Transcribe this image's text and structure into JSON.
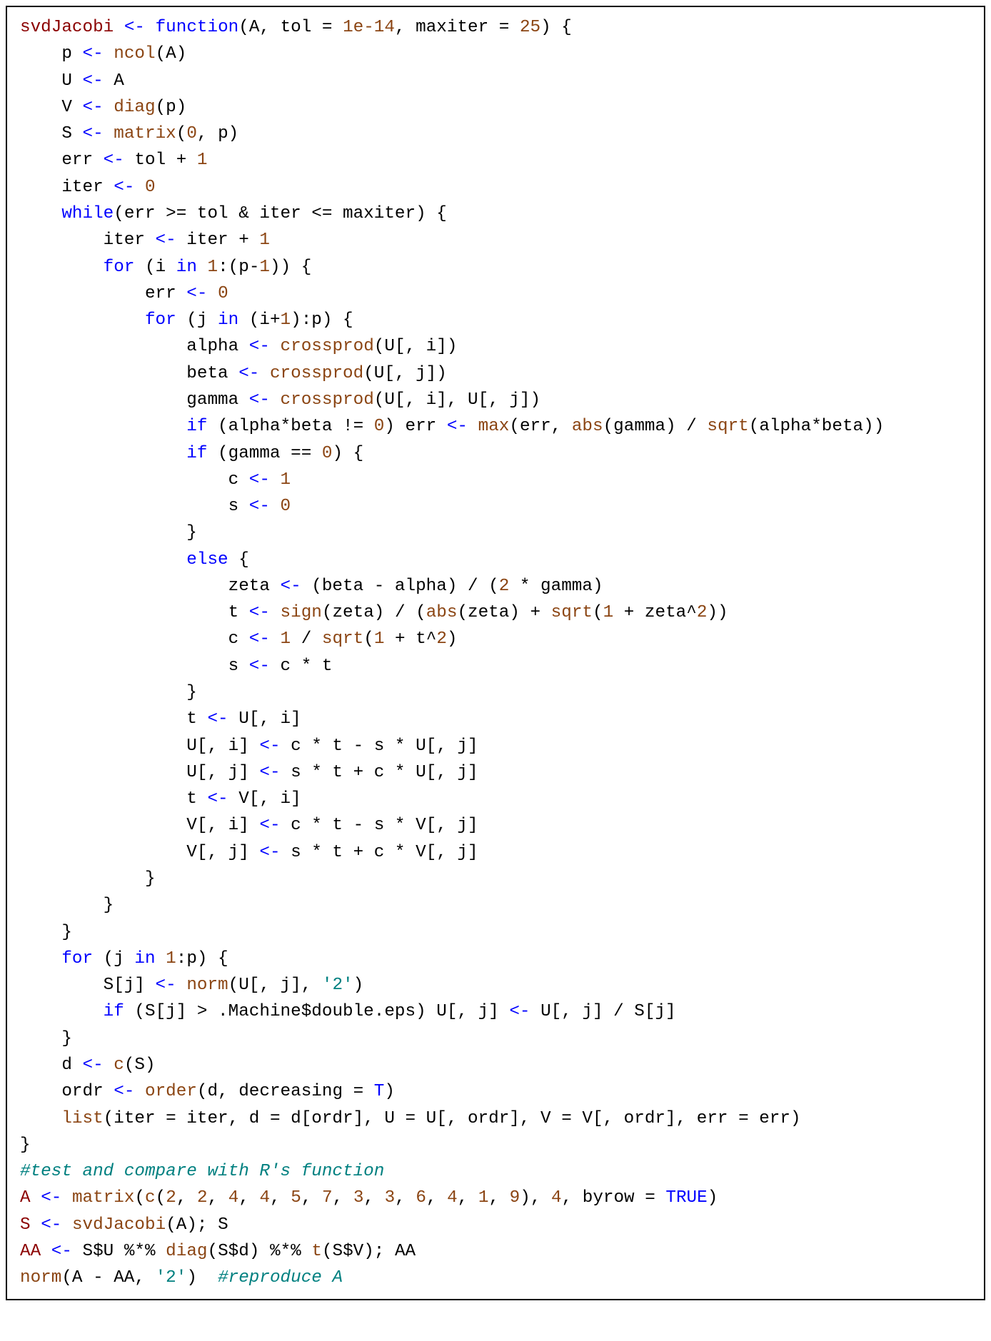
{
  "code_lines": [
    [
      [
        "name",
        "svdJacobi"
      ],
      [
        "op",
        " "
      ],
      [
        "kw",
        "<-"
      ],
      [
        "op",
        " "
      ],
      [
        "kw",
        "function"
      ],
      [
        "op",
        "(A, tol = "
      ],
      [
        "num",
        "1e-14"
      ],
      [
        "op",
        ", maxiter = "
      ],
      [
        "num",
        "25"
      ],
      [
        "op",
        ") {"
      ]
    ],
    [
      [
        "op",
        "    p "
      ],
      [
        "kw",
        "<-"
      ],
      [
        "op",
        " "
      ],
      [
        "fn",
        "ncol"
      ],
      [
        "op",
        "(A)"
      ]
    ],
    [
      [
        "op",
        "    U "
      ],
      [
        "kw",
        "<-"
      ],
      [
        "op",
        " A"
      ]
    ],
    [
      [
        "op",
        "    V "
      ],
      [
        "kw",
        "<-"
      ],
      [
        "op",
        " "
      ],
      [
        "fn",
        "diag"
      ],
      [
        "op",
        "(p)"
      ]
    ],
    [
      [
        "op",
        "    S "
      ],
      [
        "kw",
        "<-"
      ],
      [
        "op",
        " "
      ],
      [
        "fn",
        "matrix"
      ],
      [
        "op",
        "("
      ],
      [
        "num",
        "0"
      ],
      [
        "op",
        ", p)"
      ]
    ],
    [
      [
        "op",
        "    err "
      ],
      [
        "kw",
        "<-"
      ],
      [
        "op",
        " tol + "
      ],
      [
        "num",
        "1"
      ]
    ],
    [
      [
        "op",
        "    iter "
      ],
      [
        "kw",
        "<-"
      ],
      [
        "op",
        " "
      ],
      [
        "num",
        "0"
      ]
    ],
    [
      [
        "op",
        "    "
      ],
      [
        "kw",
        "while"
      ],
      [
        "op",
        "(err >= tol & iter <= maxiter) {"
      ]
    ],
    [
      [
        "op",
        "        iter "
      ],
      [
        "kw",
        "<-"
      ],
      [
        "op",
        " iter + "
      ],
      [
        "num",
        "1"
      ]
    ],
    [
      [
        "op",
        "        "
      ],
      [
        "kw",
        "for"
      ],
      [
        "op",
        " (i "
      ],
      [
        "kw",
        "in"
      ],
      [
        "op",
        " "
      ],
      [
        "num",
        "1"
      ],
      [
        "op",
        ":(p-"
      ],
      [
        "num",
        "1"
      ],
      [
        "op",
        ")) {"
      ]
    ],
    [
      [
        "op",
        "            err "
      ],
      [
        "kw",
        "<-"
      ],
      [
        "op",
        " "
      ],
      [
        "num",
        "0"
      ]
    ],
    [
      [
        "op",
        "            "
      ],
      [
        "kw",
        "for"
      ],
      [
        "op",
        " (j "
      ],
      [
        "kw",
        "in"
      ],
      [
        "op",
        " (i+"
      ],
      [
        "num",
        "1"
      ],
      [
        "op",
        "):p) {"
      ]
    ],
    [
      [
        "op",
        "                alpha "
      ],
      [
        "kw",
        "<-"
      ],
      [
        "op",
        " "
      ],
      [
        "fn",
        "crossprod"
      ],
      [
        "op",
        "(U[, i])"
      ]
    ],
    [
      [
        "op",
        "                beta "
      ],
      [
        "kw",
        "<-"
      ],
      [
        "op",
        " "
      ],
      [
        "fn",
        "crossprod"
      ],
      [
        "op",
        "(U[, j])"
      ]
    ],
    [
      [
        "op",
        "                gamma "
      ],
      [
        "kw",
        "<-"
      ],
      [
        "op",
        " "
      ],
      [
        "fn",
        "crossprod"
      ],
      [
        "op",
        "(U[, i], U[, j])"
      ]
    ],
    [
      [
        "op",
        "                "
      ],
      [
        "kw",
        "if"
      ],
      [
        "op",
        " (alpha*beta != "
      ],
      [
        "num",
        "0"
      ],
      [
        "op",
        ") err "
      ],
      [
        "kw",
        "<-"
      ],
      [
        "op",
        " "
      ],
      [
        "fn",
        "max"
      ],
      [
        "op",
        "(err, "
      ],
      [
        "fn",
        "abs"
      ],
      [
        "op",
        "(gamma) / "
      ],
      [
        "fn",
        "sqrt"
      ],
      [
        "op",
        "(alpha*beta))"
      ]
    ],
    [
      [
        "op",
        "                "
      ],
      [
        "kw",
        "if"
      ],
      [
        "op",
        " (gamma == "
      ],
      [
        "num",
        "0"
      ],
      [
        "op",
        ") {"
      ]
    ],
    [
      [
        "op",
        "                    c "
      ],
      [
        "kw",
        "<-"
      ],
      [
        "op",
        " "
      ],
      [
        "num",
        "1"
      ]
    ],
    [
      [
        "op",
        "                    s "
      ],
      [
        "kw",
        "<-"
      ],
      [
        "op",
        " "
      ],
      [
        "num",
        "0"
      ]
    ],
    [
      [
        "op",
        "                }"
      ]
    ],
    [
      [
        "op",
        "                "
      ],
      [
        "kw",
        "else"
      ],
      [
        "op",
        " {"
      ]
    ],
    [
      [
        "op",
        "                    zeta "
      ],
      [
        "kw",
        "<-"
      ],
      [
        "op",
        " (beta - alpha) / ("
      ],
      [
        "num",
        "2"
      ],
      [
        "op",
        " * gamma)"
      ]
    ],
    [
      [
        "op",
        "                    t "
      ],
      [
        "kw",
        "<-"
      ],
      [
        "op",
        " "
      ],
      [
        "fn",
        "sign"
      ],
      [
        "op",
        "(zeta) / ("
      ],
      [
        "fn",
        "abs"
      ],
      [
        "op",
        "(zeta) + "
      ],
      [
        "fn",
        "sqrt"
      ],
      [
        "op",
        "("
      ],
      [
        "num",
        "1"
      ],
      [
        "op",
        " + zeta^"
      ],
      [
        "num",
        "2"
      ],
      [
        "op",
        "))"
      ]
    ],
    [
      [
        "op",
        "                    c "
      ],
      [
        "kw",
        "<-"
      ],
      [
        "op",
        " "
      ],
      [
        "num",
        "1"
      ],
      [
        "op",
        " / "
      ],
      [
        "fn",
        "sqrt"
      ],
      [
        "op",
        "("
      ],
      [
        "num",
        "1"
      ],
      [
        "op",
        " + t^"
      ],
      [
        "num",
        "2"
      ],
      [
        "op",
        ")"
      ]
    ],
    [
      [
        "op",
        "                    s "
      ],
      [
        "kw",
        "<-"
      ],
      [
        "op",
        " c * t"
      ]
    ],
    [
      [
        "op",
        "                }"
      ]
    ],
    [
      [
        "op",
        "                t "
      ],
      [
        "kw",
        "<-"
      ],
      [
        "op",
        " U[, i]"
      ]
    ],
    [
      [
        "op",
        "                U[, i] "
      ],
      [
        "kw",
        "<-"
      ],
      [
        "op",
        " c * t - s * U[, j]"
      ]
    ],
    [
      [
        "op",
        "                U[, j] "
      ],
      [
        "kw",
        "<-"
      ],
      [
        "op",
        " s * t + c * U[, j]"
      ]
    ],
    [
      [
        "op",
        "                t "
      ],
      [
        "kw",
        "<-"
      ],
      [
        "op",
        " V[, i]"
      ]
    ],
    [
      [
        "op",
        "                V[, i] "
      ],
      [
        "kw",
        "<-"
      ],
      [
        "op",
        " c * t - s * V[, j]"
      ]
    ],
    [
      [
        "op",
        "                V[, j] "
      ],
      [
        "kw",
        "<-"
      ],
      [
        "op",
        " s * t + c * V[, j]"
      ]
    ],
    [
      [
        "op",
        "            }"
      ]
    ],
    [
      [
        "op",
        "        }"
      ]
    ],
    [
      [
        "op",
        "    }"
      ]
    ],
    [
      [
        "op",
        "    "
      ],
      [
        "kw",
        "for"
      ],
      [
        "op",
        " (j "
      ],
      [
        "kw",
        "in"
      ],
      [
        "op",
        " "
      ],
      [
        "num",
        "1"
      ],
      [
        "op",
        ":p) {"
      ]
    ],
    [
      [
        "op",
        "        S[j] "
      ],
      [
        "kw",
        "<-"
      ],
      [
        "op",
        " "
      ],
      [
        "fn",
        "norm"
      ],
      [
        "op",
        "(U[, j], "
      ],
      [
        "str",
        "'2'"
      ],
      [
        "op",
        ")"
      ]
    ],
    [
      [
        "op",
        "        "
      ],
      [
        "kw",
        "if"
      ],
      [
        "op",
        " (S[j] > .Machine$double.eps) U[, j] "
      ],
      [
        "kw",
        "<-"
      ],
      [
        "op",
        " U[, j] / S[j]"
      ]
    ],
    [
      [
        "op",
        "    }"
      ]
    ],
    [
      [
        "op",
        "    d "
      ],
      [
        "kw",
        "<-"
      ],
      [
        "op",
        " "
      ],
      [
        "fn",
        "c"
      ],
      [
        "op",
        "(S)"
      ]
    ],
    [
      [
        "op",
        "    ordr "
      ],
      [
        "kw",
        "<-"
      ],
      [
        "op",
        " "
      ],
      [
        "fn",
        "order"
      ],
      [
        "op",
        "(d, decreasing = "
      ],
      [
        "bool",
        "T"
      ],
      [
        "op",
        ")"
      ]
    ],
    [
      [
        "op",
        "    "
      ],
      [
        "fn",
        "list"
      ],
      [
        "op",
        "(iter = iter, d = d[ordr], U = U[, ordr], V = V[, ordr], err = err)"
      ]
    ],
    [
      [
        "op",
        "}"
      ]
    ],
    [
      [
        "cmt",
        "#test and compare with R's function"
      ]
    ],
    [
      [
        "name",
        "A"
      ],
      [
        "op",
        " "
      ],
      [
        "kw",
        "<-"
      ],
      [
        "op",
        " "
      ],
      [
        "fn",
        "matrix"
      ],
      [
        "op",
        "("
      ],
      [
        "fn",
        "c"
      ],
      [
        "op",
        "("
      ],
      [
        "num",
        "2"
      ],
      [
        "op",
        ", "
      ],
      [
        "num",
        "2"
      ],
      [
        "op",
        ", "
      ],
      [
        "num",
        "4"
      ],
      [
        "op",
        ", "
      ],
      [
        "num",
        "4"
      ],
      [
        "op",
        ", "
      ],
      [
        "num",
        "5"
      ],
      [
        "op",
        ", "
      ],
      [
        "num",
        "7"
      ],
      [
        "op",
        ", "
      ],
      [
        "num",
        "3"
      ],
      [
        "op",
        ", "
      ],
      [
        "num",
        "3"
      ],
      [
        "op",
        ", "
      ],
      [
        "num",
        "6"
      ],
      [
        "op",
        ", "
      ],
      [
        "num",
        "4"
      ],
      [
        "op",
        ", "
      ],
      [
        "num",
        "1"
      ],
      [
        "op",
        ", "
      ],
      [
        "num",
        "9"
      ],
      [
        "op",
        "), "
      ],
      [
        "num",
        "4"
      ],
      [
        "op",
        ", byrow = "
      ],
      [
        "bool",
        "TRUE"
      ],
      [
        "op",
        ")"
      ]
    ],
    [
      [
        "name",
        "S"
      ],
      [
        "op",
        " "
      ],
      [
        "kw",
        "<-"
      ],
      [
        "op",
        " "
      ],
      [
        "fn",
        "svdJacobi"
      ],
      [
        "op",
        "(A); S"
      ]
    ],
    [
      [
        "name",
        "AA"
      ],
      [
        "op",
        " "
      ],
      [
        "kw",
        "<-"
      ],
      [
        "op",
        " S$U %*% "
      ],
      [
        "fn",
        "diag"
      ],
      [
        "op",
        "(S$d) %*% "
      ],
      [
        "fn",
        "t"
      ],
      [
        "op",
        "(S$V); AA"
      ]
    ],
    [
      [
        "fn",
        "norm"
      ],
      [
        "op",
        "(A - AA, "
      ],
      [
        "str",
        "'2'"
      ],
      [
        "op",
        ")  "
      ],
      [
        "cmt",
        "#reproduce A"
      ]
    ]
  ]
}
